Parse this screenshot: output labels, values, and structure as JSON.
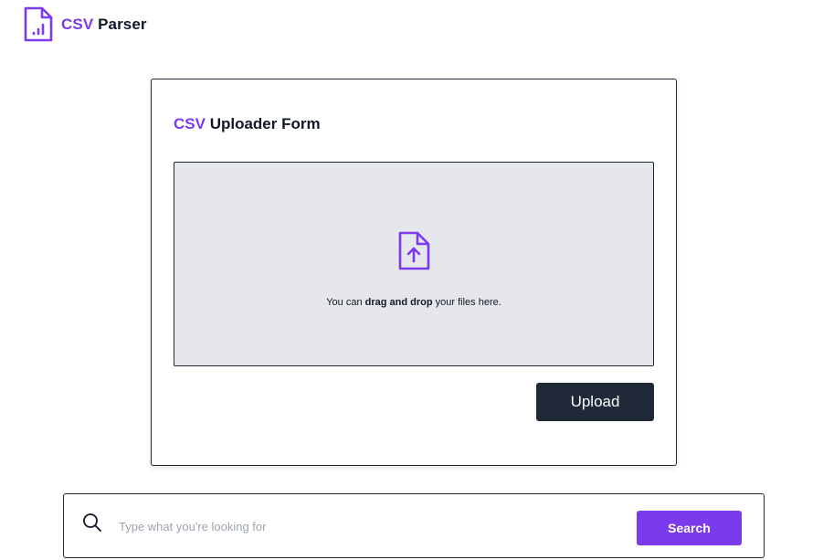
{
  "brand": {
    "name_accent": "CSV",
    "name_rest": " Parser",
    "icon": "document-chart-icon"
  },
  "uploader": {
    "title_accent": "CSV",
    "title_rest": " Uploader Form",
    "dropzone": {
      "icon": "document-upload-icon",
      "text_pre": "You can ",
      "text_bold": "drag and drop",
      "text_post": " your files here."
    },
    "upload_label": "Upload"
  },
  "search": {
    "icon": "search-icon",
    "placeholder": "Type what you're looking for",
    "value": "",
    "button_label": "Search"
  },
  "colors": {
    "accent": "#7c3aed",
    "dark": "#1f2937",
    "dropzone_bg": "#e5e7eb",
    "placeholder": "#9ca3af"
  }
}
